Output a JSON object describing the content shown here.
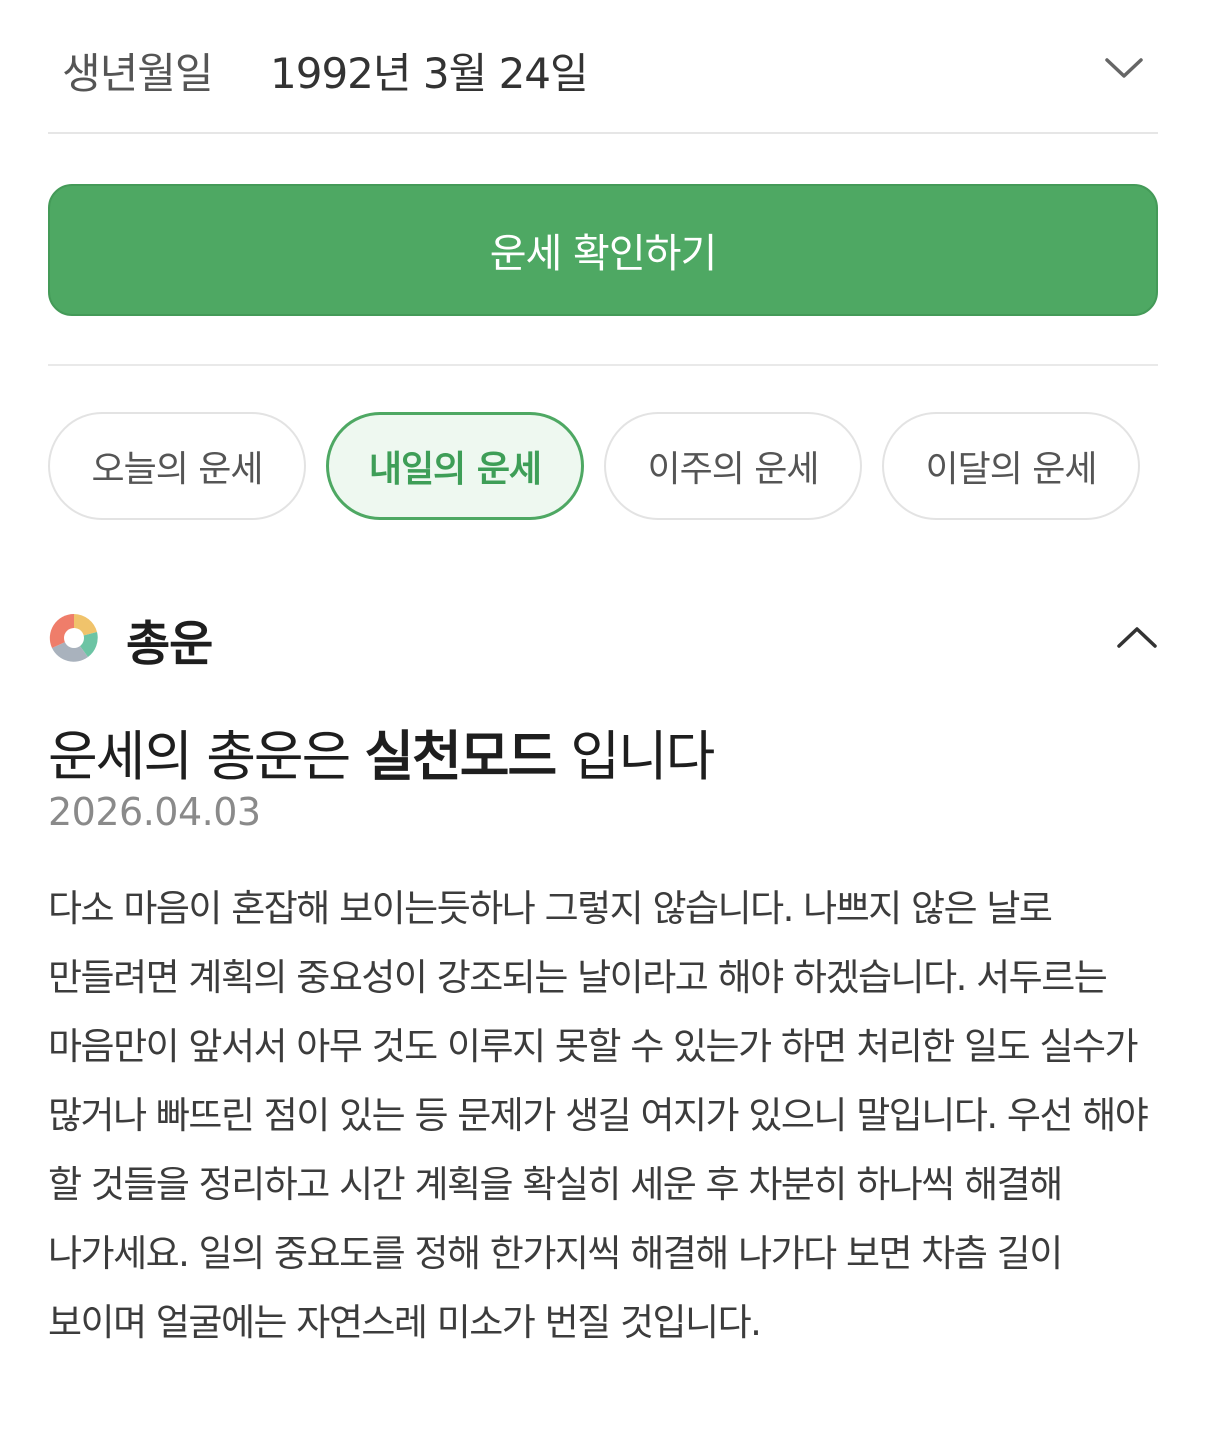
{
  "birth": {
    "label": "생년월일",
    "value": "1992년 3월 24일",
    "dropdown_icon": "chevron-down-icon"
  },
  "primary_button": {
    "label": "운세 확인하기",
    "color": "#4ea863"
  },
  "tabs": [
    {
      "label": "오늘의 운세",
      "active": false
    },
    {
      "label": "내일의 운세",
      "active": true
    },
    {
      "label": "이주의 운세",
      "active": false
    },
    {
      "label": "이달의 운세",
      "active": false
    }
  ],
  "section": {
    "icon": "pie-chart-icon",
    "title": "총운",
    "collapse_icon": "chevron-up-icon"
  },
  "result": {
    "headline_prefix": "운세의 총운은 ",
    "headline_emphasis": "실천모드",
    "headline_suffix": " 입니다",
    "date": "2026.04.03",
    "body": "다소 마음이 혼잡해 보이는듯하나 그렇지 않습니다. 나쁘지 않은 날로 만들려면 계획의 중요성이 강조되는 날이라고 해야 하겠습니다. 서두르는 마음만이 앞서서 아무 것도 이루지 못할 수 있는가 하면 처리한 일도 실수가 많거나 빠뜨린 점이 있는 등 문제가 생길 여지가 있으니 말입니다. 우선 해야 할 것들을 정리하고 시간 계획을 확실히 세운 후 차분히 하나씩 해결해 나가세요. 일의 중요도를 정해 한가지씩 해결해 나가다 보면 차츰 길이 보이며 얼굴에는 자연스레 미소가 번질 것입니다."
  }
}
